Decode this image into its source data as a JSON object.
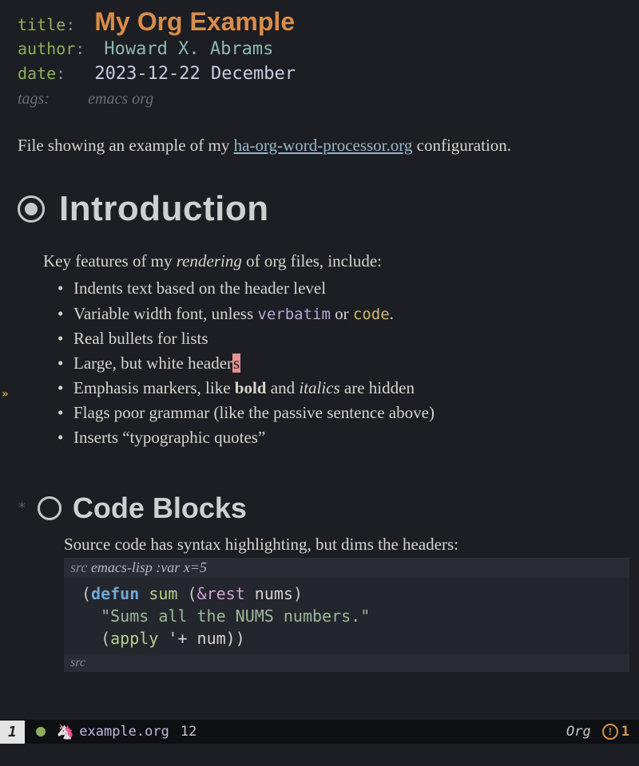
{
  "meta": {
    "title_kw": "title",
    "title": "My Org Example",
    "author_kw": "author",
    "author": "Howard X. Abrams",
    "date_kw": "date",
    "date": "2023-12-22 December",
    "tags_kw": "tags:",
    "tags": "emacs org"
  },
  "intro": {
    "pre": "File showing an example of my ",
    "link": "ha-org-word-processor.org",
    "post": " configuration."
  },
  "sections": {
    "h1": "Introduction",
    "key_features_pre": "Key features of my ",
    "rendering": "rendering",
    "key_features_post": " of org files, include:",
    "bullets": {
      "b0": "Indents text based on the header level",
      "b1_pre": "Variable width font, unless ",
      "b1_verbatim": "verbatim",
      "b1_or": " or ",
      "b1_code": "code",
      "b1_dot": ".",
      "b2": "Real bullets for lists",
      "b3_pre": "Large, but white header",
      "b3_cursor": "s",
      "b4_pre": "Emphasis markers, like ",
      "b4_bold": "bold",
      "b4_and": " and ",
      "b4_italics": "italics",
      "b4_post": " are hidden",
      "b5": "Flags poor grammar (like the passive sentence above)",
      "b6": "Inserts “typographic quotes”"
    },
    "h2_star": "*",
    "h2": "Code Blocks",
    "src_intro": "Source code has syntax highlighting, but dims the headers:",
    "src_header_kw": "src",
    "src_header_lang": "emacs-lisp :var x=5",
    "code": {
      "l1_open": "(",
      "l1_defun": "defun",
      "l1_sp": " ",
      "l1_fname": "sum",
      "l1_sp2": " (",
      "l1_amp": "&rest",
      "l1_sp3": " ",
      "l1_arg": "nums",
      "l1_close": ")",
      "l2": "\"Sums all the NUMS numbers.\"",
      "l3_open": "(",
      "l3_apply": "apply",
      "l3_rest": " '+ num))"
    },
    "src_footer": "src"
  },
  "modeline": {
    "win": "1",
    "filename": "example.org",
    "line": "12",
    "mode": "Org",
    "errors": "1"
  }
}
